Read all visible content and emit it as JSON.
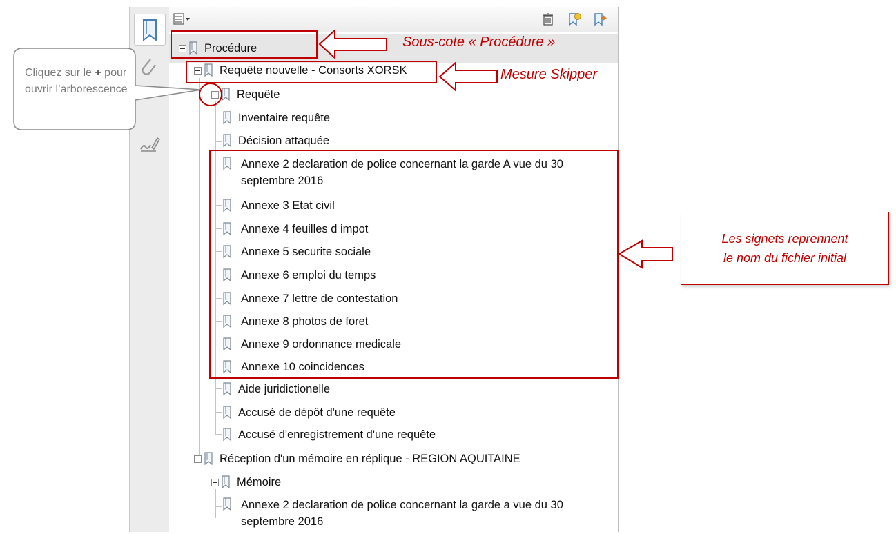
{
  "panel": {
    "icons": {
      "options": "options-menu-icon",
      "delete": "delete-bookmark-icon",
      "new": "new-bookmark-icon",
      "new_from_structure": "new-bookmark-from-structure-icon"
    },
    "tree": {
      "root": {
        "label": "Procédure"
      },
      "group1": {
        "label": "Requête nouvelle - Consorts XORSK",
        "items": [
          {
            "label": "Requête"
          },
          {
            "label": "Inventaire requête"
          },
          {
            "label": "Décision attaquée"
          }
        ],
        "annexes": [
          {
            "label": "Annexe 2 declaration de police concernant la garde A vue du 30 septembre 2016"
          },
          {
            "label": "Annexe 3 Etat civil"
          },
          {
            "label": "Annexe 4 feuilles d impot"
          },
          {
            "label": "Annexe 5 securite sociale"
          },
          {
            "label": "Annexe 6 emploi du temps"
          },
          {
            "label": "Annexe 7 lettre de contestation"
          },
          {
            "label": "Annexe 8 photos de foret"
          },
          {
            "label": "Annexe 9 ordonnance medicale"
          },
          {
            "label": "Annexe 10 coincidences"
          }
        ],
        "after": [
          {
            "label": "Aide juridictionelle"
          },
          {
            "label": "Accusé de dépôt d'une requête"
          },
          {
            "label": "Accusé d'enregistrement d'une requête"
          }
        ]
      },
      "group2": {
        "label": "Réception d'un mémoire en réplique - REGION AQUITAINE",
        "items": [
          {
            "label": "Mémoire"
          },
          {
            "label": "Annexe 2 declaration de police concernant la garde a vue du 30 septembre 2016"
          }
        ]
      }
    }
  },
  "annotations": {
    "sous_cote": "Sous-cote « Procédure »",
    "mesure": "Mesure Skipper",
    "callout_line1": "Les signets reprennent",
    "callout_line2": "le nom du fichier initial",
    "tip_part1": "Cliquez sur le ",
    "tip_plus": "+",
    "tip_part2": " pour ouvrir l’arborescence"
  },
  "colors": {
    "annotation_red": "#c00000",
    "selected_row": "#e6e6e6"
  }
}
